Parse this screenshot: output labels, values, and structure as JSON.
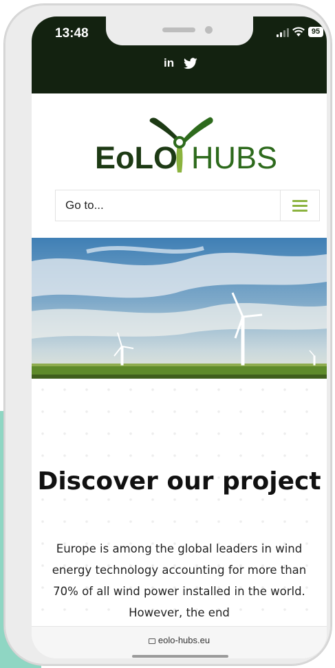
{
  "status": {
    "time": "13:48",
    "battery": "95"
  },
  "social": {
    "linkedin": "in",
    "twitter_icon": "twitter-icon"
  },
  "logo": {
    "left": "EoLO",
    "right": "HUBS"
  },
  "nav": {
    "goto_label": "Go to..."
  },
  "content": {
    "headline": "Discover our project",
    "paragraph": "Europe is among the global leaders in wind energy technology accounting for more than 70% of all wind power installed in the world. However, the end"
  },
  "browser": {
    "url": "eolo-hubs.eu"
  },
  "colors": {
    "brand_dark": "#132210",
    "brand_green": "#2d6a1c",
    "accent_green": "#8bb33e",
    "teal": "#8fd6c3"
  }
}
